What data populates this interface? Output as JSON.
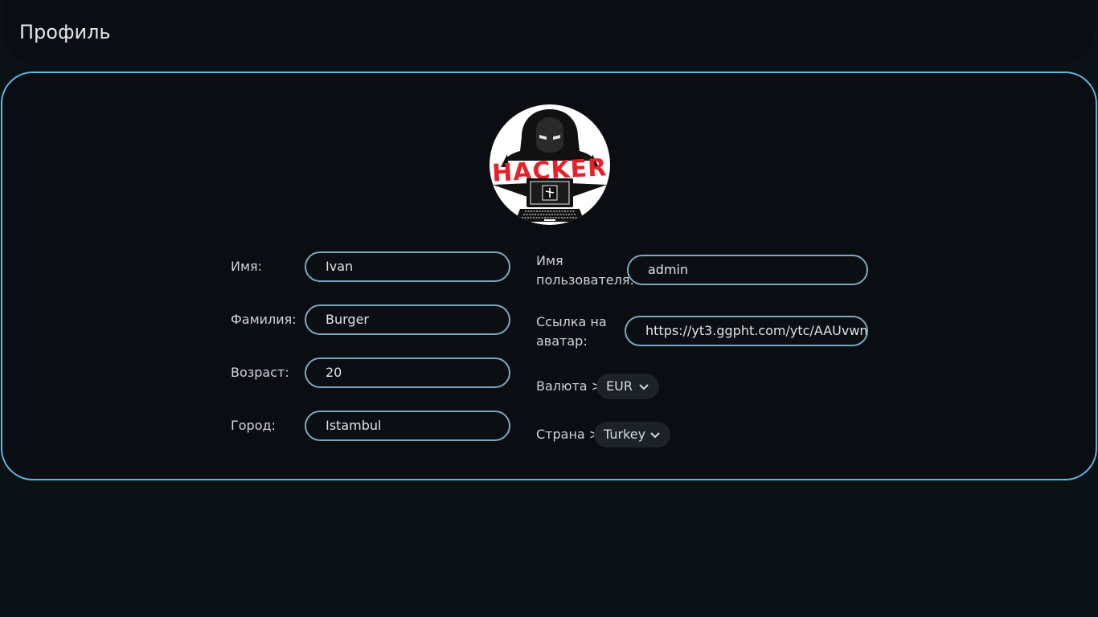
{
  "header": {
    "title": "Профиль"
  },
  "avatar": {
    "text": "HACKER",
    "icon": "hacker-avatar"
  },
  "form": {
    "first_name": {
      "label": "Имя:",
      "value": "Ivan"
    },
    "last_name": {
      "label": "Фамилия:",
      "value": "Burger"
    },
    "age": {
      "label": "Возраст:",
      "value": "20"
    },
    "city": {
      "label": "Город:",
      "value": "Istambul"
    },
    "username": {
      "label_line1": "Имя",
      "label_line2": "пользователя:",
      "value": "admin"
    },
    "avatar_link": {
      "label_line1": "Ссылка на",
      "label_line2": "аватар:",
      "value": "https://yt3.ggpht.com/ytc/AAUvwn"
    },
    "currency": {
      "label": "Валюта >",
      "value": "EUR"
    },
    "country": {
      "label": "Страна >",
      "value": "Turkey"
    }
  },
  "colors": {
    "accent": "#5bb8dd",
    "field_border": "#7aa9be",
    "background": "#0c1116",
    "hacker_red": "#e8202a"
  }
}
